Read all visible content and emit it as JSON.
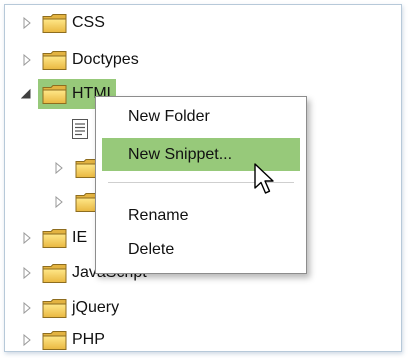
{
  "tree": {
    "items": [
      {
        "label": "CSS",
        "expanded": false
      },
      {
        "label": "Doctypes",
        "expanded": false
      },
      {
        "label": "HTML",
        "expanded": true,
        "selected": true
      },
      {
        "label": "IE",
        "expanded": false
      },
      {
        "label": "JavaScript",
        "expanded": false
      },
      {
        "label": "jQuery",
        "expanded": false
      },
      {
        "label": "PHP",
        "expanded": false
      }
    ],
    "selection_color": "#97c97a"
  },
  "context_menu": {
    "items": [
      {
        "label": "New Folder",
        "highlighted": false
      },
      {
        "label": "New Snippet...",
        "highlighted": true
      },
      {
        "label": "Rename",
        "highlighted": false
      },
      {
        "label": "Delete",
        "highlighted": false
      }
    ],
    "highlight_color": "#97c97a"
  },
  "icons": {
    "folder": "folder-icon",
    "snippet": "document-icon",
    "collapsed": "triangle-right-icon",
    "expanded": "triangle-down-icon",
    "pointer": "mouse-cursor-icon"
  }
}
